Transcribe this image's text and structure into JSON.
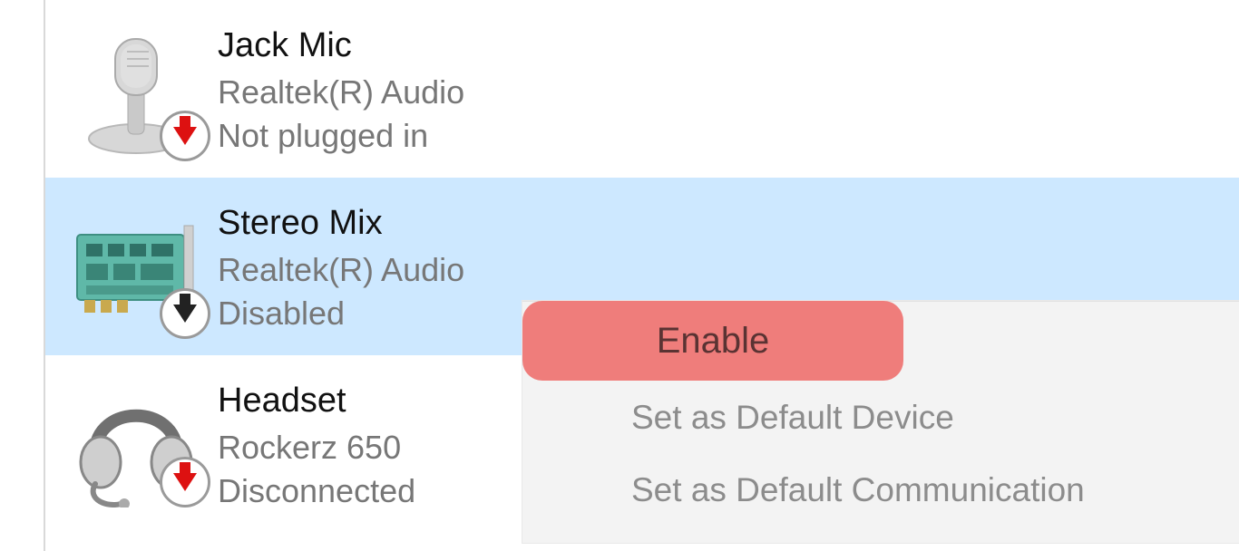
{
  "devices": [
    {
      "name": "Jack Mic",
      "driver": "Realtek(R) Audio",
      "status": "Not plugged in"
    },
    {
      "name": "Stereo Mix",
      "driver": "Realtek(R) Audio",
      "status": "Disabled"
    },
    {
      "name": "Headset",
      "driver": "Rockerz 650",
      "status": "Disconnected"
    }
  ],
  "context_menu": {
    "items": [
      {
        "label": "Enable"
      },
      {
        "label": "Set as Default Device"
      },
      {
        "label": "Set as Default Communication"
      }
    ]
  },
  "highlight_label": "Enable"
}
